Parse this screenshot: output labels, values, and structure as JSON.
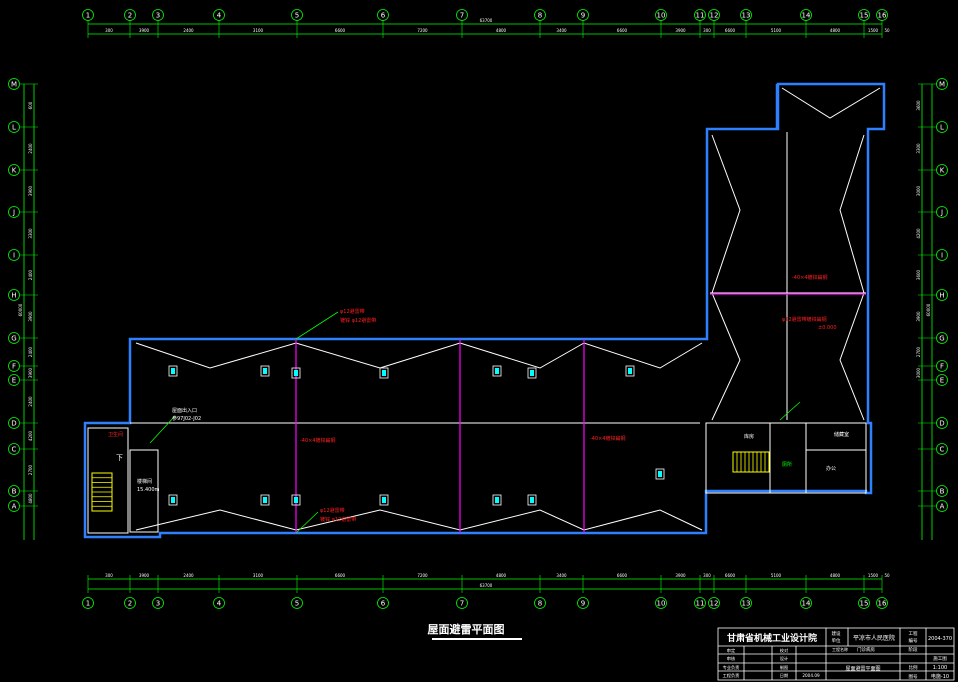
{
  "drawing": {
    "title": "屋面避雷平面图",
    "colors": {
      "background": "#000000",
      "axis": "#00ff00",
      "wall": "#2f80ff",
      "roof_line": "#ffffff",
      "lightning_conductor": "#ff00ff",
      "annotation": "#ff2020",
      "fixture": "#00ffff",
      "stair": "#ffff00",
      "title_block": "#ffffff"
    },
    "grid_axes_x": [
      "1",
      "2",
      "3",
      "4",
      "5",
      "6",
      "7",
      "8",
      "9",
      "10",
      "11",
      "12",
      "13",
      "14",
      "15",
      "16"
    ],
    "grid_axes_y": [
      "M",
      "L",
      "K",
      "J",
      "I",
      "H",
      "G",
      "F",
      "E",
      "D",
      "C",
      "B",
      "A"
    ],
    "dims_top": [
      "300",
      "3900",
      "2400",
      "3100",
      "6600",
      "7200",
      "4800",
      "3400",
      "6600",
      "3900",
      "300",
      "6600",
      "5100",
      "4800",
      "1500",
      "50"
    ],
    "dims_bottom": [
      "300",
      "3900",
      "2400",
      "3100",
      "6600",
      "7200",
      "4800",
      "3400",
      "6600",
      "3900",
      "300",
      "6600",
      "5100",
      "4800",
      "1500",
      "50"
    ],
    "dim_total_top": "63700",
    "dim_total_bottom": "63700",
    "dims_left": [
      "600",
      "2400",
      "3900",
      "3300",
      "2400",
      "3900",
      "2400",
      "3900",
      "2400",
      "4200",
      "2700",
      "4800",
      "3900"
    ],
    "dims_left_total": "60000",
    "dims_right": [
      "3600",
      "3300",
      "3000",
      "4200",
      "3600",
      "3900",
      "2700",
      "3000"
    ],
    "dims_right_total": "60000",
    "annotations": {
      "down_conductor_top": "φ12避雷带",
      "down_conductor_top_sub": "镀锌 φ12避雷带",
      "roof_access": "屋面出入口",
      "roof_access_ref": "参97J02-J02",
      "conductor_left": "-40×4镀锌扁钢",
      "conductor_mid": "-40×4镀锌扁钢",
      "conductor_right": "-40×4镀锌扁钢",
      "down_conductor_bottom": "φ12避雷带",
      "down_conductor_bottom_sub": "镀锌 φ12避雷带",
      "wing_label": "φ12避雷带镀锌扁钢",
      "wing_label_sub": "±0.000",
      "stair_down": "下",
      "stair_room": "楼梯间",
      "stair_room_level": "15.400m",
      "room_a": "卫生间",
      "room_b": "库房",
      "room_c": "储藏室",
      "room_d": "办公",
      "room_e": "厕所"
    },
    "title_block": {
      "institute": "甘肃省机械工业设计院",
      "project_label_1": "建设",
      "project_label_2": "单位",
      "project_name": "平凉市人民医院",
      "sub_project_label": "工程名称",
      "sub_project": "门诊病房",
      "code_label_1": "工程",
      "code_label_2": "编号",
      "code": "2004-370",
      "drawing_name": "屋面避雷平面图",
      "rows": [
        {
          "label": "审定",
          "value": "",
          "label2": "校对",
          "value2": ""
        },
        {
          "label": "审核",
          "value": "",
          "label2": "设计",
          "value2": ""
        },
        {
          "label": "专业负责",
          "value": "",
          "label2": "制图",
          "value2": ""
        },
        {
          "label": "工程负责",
          "value": "",
          "label2": "日期",
          "value2": "2004.09"
        }
      ],
      "stage_label": "阶段",
      "stage": "施工图",
      "scale_label": "比例",
      "scale": "1:100",
      "sheet_label": "图号",
      "sheet": "电施-10"
    }
  }
}
